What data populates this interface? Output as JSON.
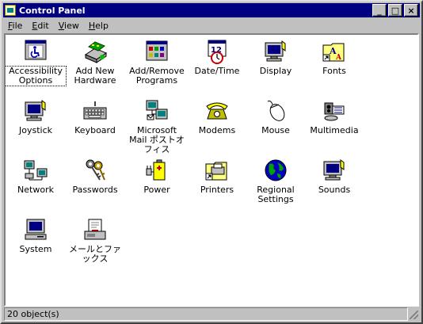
{
  "window": {
    "title": "Control Panel"
  },
  "controls": {
    "minimize": "_",
    "maximize": "□",
    "close": "×"
  },
  "menu": {
    "file": {
      "key": "F",
      "rest": "ile"
    },
    "edit": {
      "key": "E",
      "rest": "dit"
    },
    "view": {
      "key": "V",
      "rest": "iew"
    },
    "help": {
      "key": "H",
      "rest": "elp"
    }
  },
  "icons": [
    {
      "label": "Accessibility\nOptions",
      "icon": "accessibility-icon",
      "selected": true
    },
    {
      "label": "Add New\nHardware",
      "icon": "hardware-icon"
    },
    {
      "label": "Add/Remove\nPrograms",
      "icon": "programs-icon"
    },
    {
      "label": "Date/Time",
      "icon": "calendar-clock-icon"
    },
    {
      "label": "Display",
      "icon": "monitor-icon"
    },
    {
      "label": "Fonts",
      "icon": "fonts-folder-icon"
    },
    {
      "label": "Joystick",
      "icon": "joystick-icon"
    },
    {
      "label": "Keyboard",
      "icon": "keyboard-icon"
    },
    {
      "label": "Microsoft\nMail ポストオ\nフィス",
      "icon": "mail-postoffice-icon"
    },
    {
      "label": "Modems",
      "icon": "telephone-icon"
    },
    {
      "label": "Mouse",
      "icon": "mouse-icon"
    },
    {
      "label": "Multimedia",
      "icon": "multimedia-icon"
    },
    {
      "label": "Network",
      "icon": "network-icon"
    },
    {
      "label": "Passwords",
      "icon": "keys-icon"
    },
    {
      "label": "Power",
      "icon": "battery-icon"
    },
    {
      "label": "Printers",
      "icon": "printer-folder-icon"
    },
    {
      "label": "Regional\nSettings",
      "icon": "globe-icon"
    },
    {
      "label": "Sounds",
      "icon": "speaker-icon"
    },
    {
      "label": "System",
      "icon": "computer-icon"
    },
    {
      "label": "メールとファックス",
      "icon": "mail-fax-icon"
    }
  ],
  "status": {
    "text": "20 object(s)"
  }
}
